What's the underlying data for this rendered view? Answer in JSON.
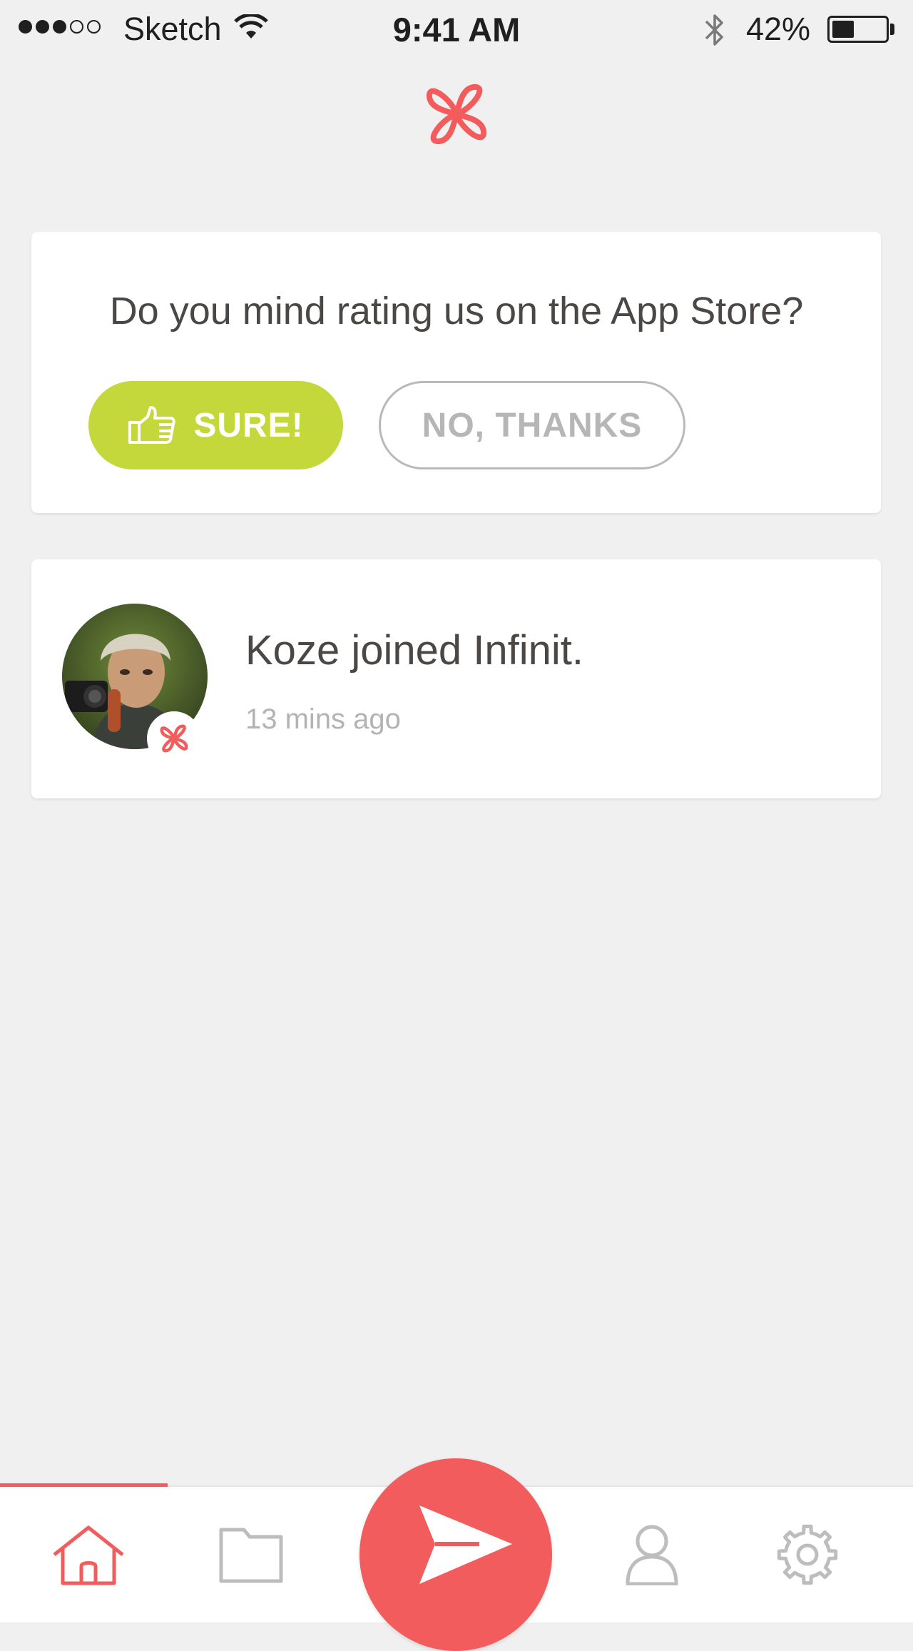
{
  "status_bar": {
    "carrier": "Sketch",
    "time": "9:41 AM",
    "battery_percent_label": "42%",
    "battery_level": 0.42,
    "signal_bars_filled": 3,
    "signal_bars_total": 5
  },
  "header": {
    "logo_icon": "infinit-logo-icon"
  },
  "rating_card": {
    "question": "Do you mind rating us on the App Store?",
    "sure_label": "SURE!",
    "no_label": "NO, THANKS"
  },
  "activity": {
    "text": "Koze joined Infinit.",
    "time": "13 mins ago"
  },
  "tab_bar": {
    "tabs": [
      "home-icon",
      "folder-icon",
      "send-icon",
      "user-icon",
      "gear-icon"
    ],
    "active_tab": "home-icon"
  },
  "colors": {
    "accent": "#f25c5c",
    "sure_button": "#c4d83b",
    "background": "#f0f0f0",
    "text": "#4a4744",
    "muted": "#b3b3b3"
  }
}
